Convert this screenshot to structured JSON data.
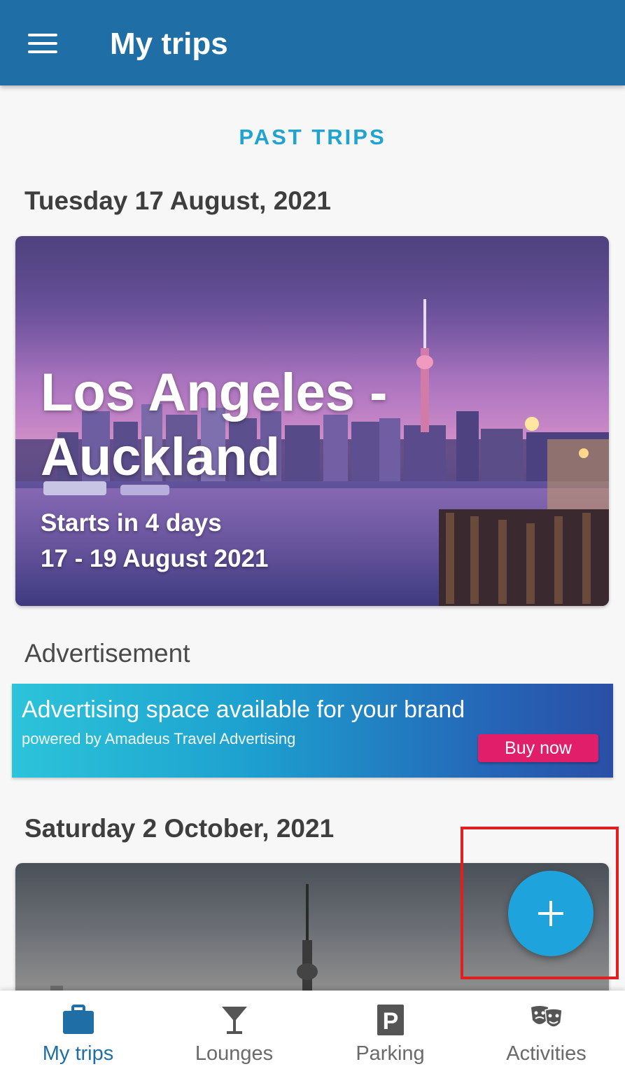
{
  "appbar": {
    "title": "My trips",
    "menu_icon": "hamburger-menu-icon"
  },
  "past_trips_label": "PAST TRIPS",
  "trips": [
    {
      "date_heading": "Tuesday 17 August, 2021",
      "title": "Los Angeles - Auckland",
      "starts": "Starts in 4 days",
      "dates": "17 - 19 August 2021"
    },
    {
      "date_heading": "Saturday 2 October, 2021"
    }
  ],
  "advertisement": {
    "label": "Advertisement",
    "headline": "Advertising space available for your brand",
    "subline": "powered by Amadeus Travel Advertising",
    "button": "Buy now"
  },
  "fab": {
    "icon": "plus-icon"
  },
  "bottom_nav": {
    "items": [
      {
        "label": "My trips",
        "icon": "briefcase-icon",
        "active": true
      },
      {
        "label": "Lounges",
        "icon": "cocktail-glass-icon",
        "active": false
      },
      {
        "label": "Parking",
        "icon": "parking-icon",
        "active": false
      },
      {
        "label": "Activities",
        "icon": "theater-masks-icon",
        "active": false
      }
    ]
  },
  "colors": {
    "primary": "#1f6fa6",
    "accent": "#1ea3dc",
    "highlight": "#e02020",
    "ad_button": "#e01e6a"
  }
}
